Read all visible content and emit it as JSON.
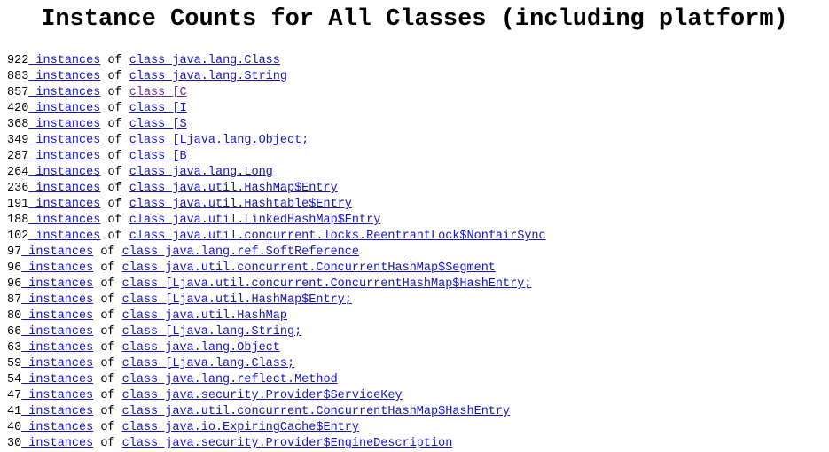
{
  "page": {
    "title": "Instance Counts for All Classes (including platform)",
    "link_color": "#1414c8",
    "visited_link_color": "#6b2c91",
    "text_color": "#000000",
    "background_color": "#ffffff",
    "instances_label": "instances",
    "of_label": "of",
    "class_prefix": "class "
  },
  "chart_data": {
    "type": "table",
    "title": "Instance Counts for All Classes (including platform)",
    "xlabel": "",
    "ylabel": "instances",
    "categories": [
      "java.lang.Class",
      "java.lang.String",
      "[C",
      "[I",
      "[S",
      "[Ljava.lang.Object;",
      "[B",
      "java.lang.Long",
      "java.util.HashMap$Entry",
      "java.util.Hashtable$Entry",
      "java.util.LinkedHashMap$Entry",
      "java.util.concurrent.locks.ReentrantLock$NonfairSync",
      "java.lang.ref.SoftReference",
      "java.util.concurrent.ConcurrentHashMap$Segment",
      "[Ljava.util.concurrent.ConcurrentHashMap$HashEntry;",
      "[Ljava.util.HashMap$Entry;",
      "java.util.HashMap",
      "[Ljava.lang.String;",
      "java.lang.Object",
      "[Ljava.lang.Class;",
      "java.lang.reflect.Method",
      "java.security.Provider$ServiceKey",
      "java.util.concurrent.ConcurrentHashMap$HashEntry",
      "java.io.ExpiringCache$Entry",
      "java.security.Provider$EngineDescription"
    ],
    "values": [
      922,
      883,
      857,
      420,
      368,
      349,
      287,
      264,
      236,
      191,
      188,
      102,
      97,
      96,
      96,
      87,
      80,
      66,
      63,
      59,
      54,
      47,
      41,
      40,
      30
    ]
  },
  "rows": [
    {
      "count": "922",
      "class_name": "class java.lang.Class",
      "visited": false
    },
    {
      "count": "883",
      "class_name": "class java.lang.String",
      "visited": false
    },
    {
      "count": "857",
      "class_name": "class [C",
      "visited": true
    },
    {
      "count": "420",
      "class_name": "class [I",
      "visited": false
    },
    {
      "count": "368",
      "class_name": "class [S",
      "visited": false
    },
    {
      "count": "349",
      "class_name": "class [Ljava.lang.Object;",
      "visited": false
    },
    {
      "count": "287",
      "class_name": "class [B",
      "visited": false
    },
    {
      "count": "264",
      "class_name": "class java.lang.Long",
      "visited": false
    },
    {
      "count": "236",
      "class_name": "class java.util.HashMap$Entry",
      "visited": false
    },
    {
      "count": "191",
      "class_name": "class java.util.Hashtable$Entry",
      "visited": false
    },
    {
      "count": "188",
      "class_name": "class java.util.LinkedHashMap$Entry",
      "visited": false
    },
    {
      "count": "102",
      "class_name": "class java.util.concurrent.locks.ReentrantLock$NonfairSync",
      "visited": false
    },
    {
      "count": "97",
      "class_name": "class java.lang.ref.SoftReference",
      "visited": false
    },
    {
      "count": "96",
      "class_name": "class java.util.concurrent.ConcurrentHashMap$Segment",
      "visited": false
    },
    {
      "count": "96",
      "class_name": "class [Ljava.util.concurrent.ConcurrentHashMap$HashEntry;",
      "visited": false
    },
    {
      "count": "87",
      "class_name": "class [Ljava.util.HashMap$Entry;",
      "visited": false
    },
    {
      "count": "80",
      "class_name": "class java.util.HashMap",
      "visited": false
    },
    {
      "count": "66",
      "class_name": "class [Ljava.lang.String;",
      "visited": false
    },
    {
      "count": "63",
      "class_name": "class java.lang.Object",
      "visited": false
    },
    {
      "count": "59",
      "class_name": "class [Ljava.lang.Class;",
      "visited": false
    },
    {
      "count": "54",
      "class_name": "class java.lang.reflect.Method",
      "visited": false
    },
    {
      "count": "47",
      "class_name": "class java.security.Provider$ServiceKey",
      "visited": false
    },
    {
      "count": "41",
      "class_name": "class java.util.concurrent.ConcurrentHashMap$HashEntry",
      "visited": false
    },
    {
      "count": "40",
      "class_name": "class java.io.ExpiringCache$Entry",
      "visited": false
    },
    {
      "count": "30",
      "class_name": "class java.security.Provider$EngineDescription",
      "visited": false
    }
  ]
}
